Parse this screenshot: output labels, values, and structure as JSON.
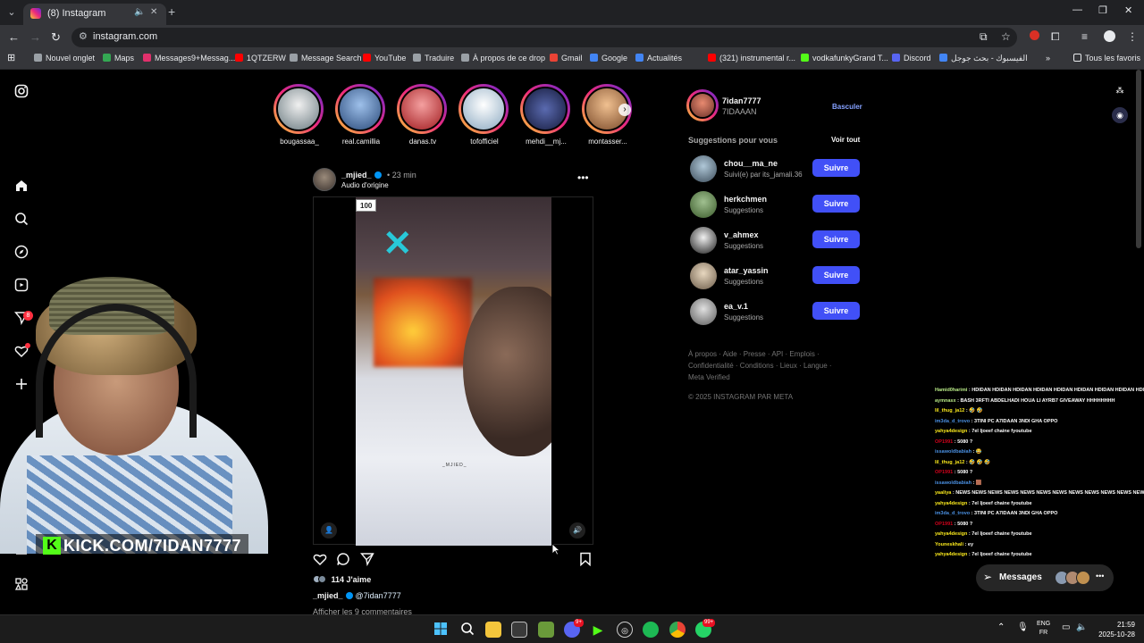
{
  "browser": {
    "tab_title": "(8) Instagram",
    "url": "instagram.com",
    "bookmarks": [
      {
        "label": "Nouvel onglet",
        "color": "#9aa0a6"
      },
      {
        "label": "Maps",
        "color": "#34a853"
      },
      {
        "label": "Messages9+Messag...",
        "color": "#e1306c"
      },
      {
        "label": "1QTZERW",
        "color": "#ff0000"
      },
      {
        "label": "Message Search",
        "color": "#9aa0a6"
      },
      {
        "label": "YouTube",
        "color": "#ff0000"
      },
      {
        "label": "Traduire",
        "color": "#9aa0a6"
      },
      {
        "label": "À propos de ce drop",
        "color": "#9aa0a6"
      },
      {
        "label": "Gmail",
        "color": "#ea4335"
      },
      {
        "label": "Google",
        "color": "#4285f4"
      },
      {
        "label": "Actualités",
        "color": "#4285f4"
      },
      {
        "label": "(321) instrumental r...",
        "color": "#ff0000"
      },
      {
        "label": "vodkafunkyGrand T...",
        "color": "#53fc18"
      },
      {
        "label": "Discord",
        "color": "#5865f2"
      },
      {
        "label": "الفيسبوك - بحث جوجل",
        "color": "#4285f4"
      }
    ],
    "all_bookmarks": "Tous les favoris"
  },
  "sidenav": {
    "notif_badge": "8"
  },
  "stories": [
    {
      "name": "bougassaa_",
      "color": "#dfe7ea"
    },
    {
      "name": "real.camillia",
      "color": "#6a9bd8"
    },
    {
      "name": "danas.tv",
      "color": "#d8262a"
    },
    {
      "name": "tofofficiel",
      "color": "#c9d9e6"
    },
    {
      "name": "mehdi__mj...",
      "color": "#3a4a8a"
    },
    {
      "name": "montasser...",
      "color": "#d99c6a"
    }
  ],
  "post": {
    "username": "_mjied_",
    "time": "23 min",
    "audio": "Audio d'origine",
    "video_chip": "100",
    "shirt_text": "_MJIED_",
    "likes": "114 J'aime",
    "caption_user": "_mjied_",
    "caption_mention": "@7idan7777",
    "comments_link": "Afficher les 9 commentaires"
  },
  "profile": {
    "username": "7idan7777",
    "name": "7IDAAAN",
    "switch_label": "Basculer"
  },
  "suggestions": {
    "title": "Suggestions pour vous",
    "see_all": "Voir tout",
    "follow_label": "Suivre",
    "items": [
      {
        "user": "chou__ma_ne",
        "sub": "Suivi(e) par its_jamali.36",
        "color": "#8aa0b0"
      },
      {
        "user": "herkchmen",
        "sub": "Suggestions",
        "color": "#6a8a5a"
      },
      {
        "user": "v_ahmex",
        "sub": "Suggestions",
        "color": "#d8d8d8"
      },
      {
        "user": "atar_yassin",
        "sub": "Suggestions",
        "color": "#c8b8a0"
      },
      {
        "user": "ea_v.1",
        "sub": "Suggestions",
        "color": "#b0b0b0"
      }
    ]
  },
  "footer": {
    "links": "À propos · Aide · Presse · API · Emplois · Confidentialité · Conditions · Lieux · Langue · Meta Verified",
    "copyright": "© 2025 INSTAGRAM PAR META"
  },
  "stream": {
    "kick_url": "KICK.COM/7IDAN7777",
    "chat": [
      {
        "user": "Hamid0harimi",
        "text": "HDIDAN HDIDAN HDIDAN HDIDAN HDIDAN HDIDAN HDIDAN HDIDAN HDIDAN HDIDAN HDIDAN HDIDAN HDIDAN HDIDAN HDIDAN HDIDAN",
        "color": "#b8e986"
      },
      {
        "user": "aymnasx",
        "text": "BASH 3RFTI ABDELHADI HOUA LI AYRB7 GIVEAWAY HHHHHHHH",
        "color": "#b8e986"
      },
      {
        "user": "lil_thug_ja12",
        "text": "🤣 🤣",
        "color": "#f8e71c"
      },
      {
        "user": "im3da_d_trovo",
        "text": "3TINI PC A7IDAAN 3NDI GHA OPPO",
        "color": "#4a90e2"
      },
      {
        "user": "yahya4design",
        "text": "7el ljoeef chaine fyoutube",
        "color": "#f8e71c"
      },
      {
        "user": "OP1991",
        "text": "5080 ?",
        "color": "#d0021b"
      },
      {
        "user": "issawoldbabiah",
        "text": "😂",
        "color": "#4a90e2"
      },
      {
        "user": "lil_thug_ja12",
        "text": "🤣 🤣 🤣",
        "color": "#f8e71c"
      },
      {
        "user": "OP1991",
        "text": "5080 ?",
        "color": "#d0021b"
      },
      {
        "user": "issawoldbabiah",
        "text": "🟫",
        "color": "#4a90e2"
      },
      {
        "user": "yaaliya",
        "text": "NEWS NEWS NEWS NEWS NEWS NEWS NEWS NEWS NEWS NEWS NEWS NEWS NEWS NEWS NEWS NEWS NEWS NEWS NEWS NEWS NEWS NEWS NEWS NEWS NEWS NEWS NEWS NEWS NEWS NEWS NEWS NEWS NEWS NEWS NEWS NEWS NEWS NEWS NEWS NEWS NEWS NEWS NEWS NEWS NEWS NEWS",
        "color": "#f8e71c"
      },
      {
        "user": "yahya4design",
        "text": "7el ljoeef chaine fyoutube",
        "color": "#f8e71c"
      },
      {
        "user": "im3da_d_trovo",
        "text": "3TINI PC A7IDAAN 3NDI GHA OPPO",
        "color": "#4a90e2"
      },
      {
        "user": "OP1991",
        "text": "5080 ?",
        "color": "#d0021b"
      },
      {
        "user": "yahya4design",
        "text": "7el ljoeef chaine fyoutube",
        "color": "#f8e71c"
      },
      {
        "user": "Youneskhali",
        "text": "ey",
        "color": "#f8e71c"
      },
      {
        "user": "yahya4design",
        "text": "7el ljoeef chaine fyoutube",
        "color": "#f8e71c"
      }
    ],
    "messages_label": "Messages"
  },
  "taskbar": {
    "discord_badge": "9+",
    "whatsapp_badge": "99+",
    "lang_line1": "ENG",
    "lang_line2": "FR",
    "time": "21:59",
    "date": "2025-10-28"
  }
}
